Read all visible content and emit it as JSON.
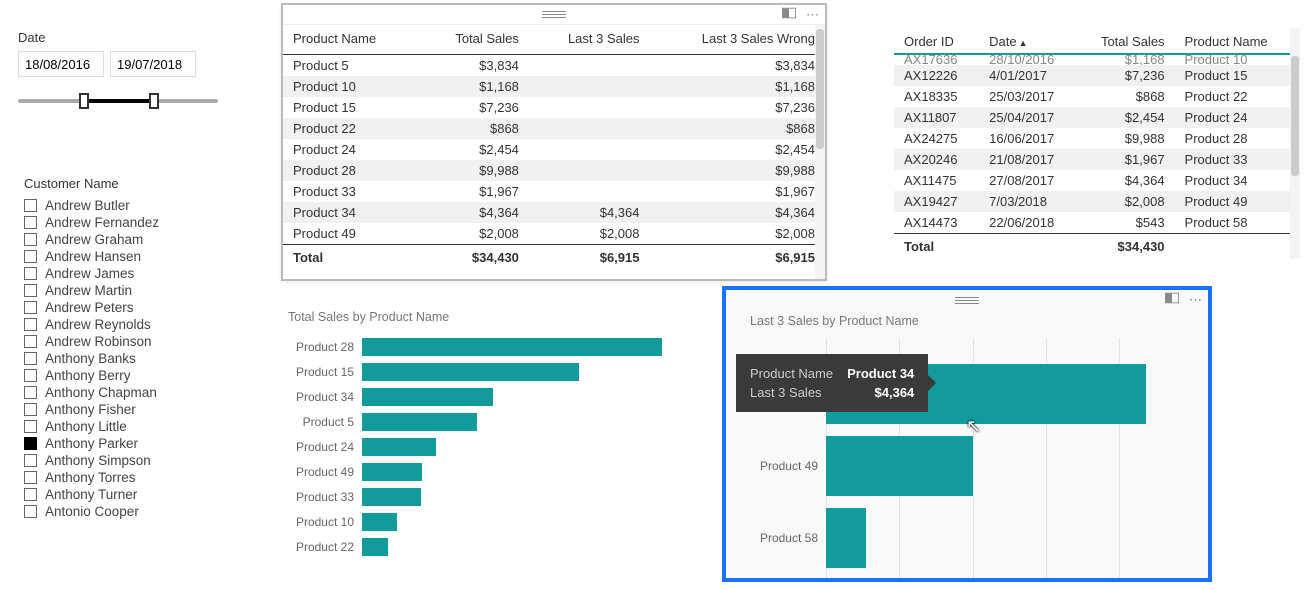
{
  "date_slicer": {
    "label": "Date",
    "start": "18/08/2016",
    "end": "19/07/2018",
    "range_start_pct": 33,
    "range_end_pct": 68
  },
  "customer_slicer": {
    "label": "Customer Name",
    "items": [
      {
        "name": "Andrew Butler",
        "checked": false
      },
      {
        "name": "Andrew Fernandez",
        "checked": false
      },
      {
        "name": "Andrew Graham",
        "checked": false
      },
      {
        "name": "Andrew Hansen",
        "checked": false
      },
      {
        "name": "Andrew James",
        "checked": false
      },
      {
        "name": "Andrew Martin",
        "checked": false
      },
      {
        "name": "Andrew Peters",
        "checked": false
      },
      {
        "name": "Andrew Reynolds",
        "checked": false
      },
      {
        "name": "Andrew Robinson",
        "checked": false
      },
      {
        "name": "Anthony Banks",
        "checked": false
      },
      {
        "name": "Anthony Berry",
        "checked": false
      },
      {
        "name": "Anthony Chapman",
        "checked": false
      },
      {
        "name": "Anthony Fisher",
        "checked": false
      },
      {
        "name": "Anthony Little",
        "checked": false
      },
      {
        "name": "Anthony Parker",
        "checked": true
      },
      {
        "name": "Anthony Simpson",
        "checked": false
      },
      {
        "name": "Anthony Torres",
        "checked": false
      },
      {
        "name": "Anthony Turner",
        "checked": false
      },
      {
        "name": "Antonio Cooper",
        "checked": false
      }
    ]
  },
  "table1": {
    "headers": [
      "Product Name",
      "Total Sales",
      "Last 3 Sales",
      "Last 3 Sales Wrong"
    ],
    "rows": [
      {
        "product": "Product 5",
        "total": "$3,834",
        "last3": "",
        "last3w": "$3,834"
      },
      {
        "product": "Product 10",
        "total": "$1,168",
        "last3": "",
        "last3w": "$1,168"
      },
      {
        "product": "Product 15",
        "total": "$7,236",
        "last3": "",
        "last3w": "$7,236"
      },
      {
        "product": "Product 22",
        "total": "$868",
        "last3": "",
        "last3w": "$868"
      },
      {
        "product": "Product 24",
        "total": "$2,454",
        "last3": "",
        "last3w": "$2,454"
      },
      {
        "product": "Product 28",
        "total": "$9,988",
        "last3": "",
        "last3w": "$9,988"
      },
      {
        "product": "Product 33",
        "total": "$1,967",
        "last3": "",
        "last3w": "$1,967"
      },
      {
        "product": "Product 34",
        "total": "$4,364",
        "last3": "$4,364",
        "last3w": "$4,364"
      },
      {
        "product": "Product 49",
        "total": "$2,008",
        "last3": "$2,008",
        "last3w": "$2,008"
      }
    ],
    "footer": {
      "label": "Total",
      "total": "$34,430",
      "last3": "$6,915",
      "last3w": "$6,915"
    }
  },
  "table2": {
    "headers": [
      "Order ID",
      "Date",
      "Total Sales",
      "Product Name"
    ],
    "sort_col": 1,
    "partial_row": {
      "order": "AX17636",
      "date": "28/10/2016",
      "total": "$1,168",
      "product": "Product 10"
    },
    "rows": [
      {
        "order": "AX12226",
        "date": "4/01/2017",
        "total": "$7,236",
        "product": "Product 15"
      },
      {
        "order": "AX18335",
        "date": "25/03/2017",
        "total": "$868",
        "product": "Product 22"
      },
      {
        "order": "AX11807",
        "date": "25/04/2017",
        "total": "$2,454",
        "product": "Product 24"
      },
      {
        "order": "AX24275",
        "date": "16/06/2017",
        "total": "$9,988",
        "product": "Product 28"
      },
      {
        "order": "AX20246",
        "date": "21/08/2017",
        "total": "$1,967",
        "product": "Product 33"
      },
      {
        "order": "AX11475",
        "date": "27/08/2017",
        "total": "$4,364",
        "product": "Product 34"
      },
      {
        "order": "AX19427",
        "date": "7/03/2018",
        "total": "$2,008",
        "product": "Product 49"
      },
      {
        "order": "AX14473",
        "date": "22/06/2018",
        "total": "$543",
        "product": "Product 58"
      }
    ],
    "footer": {
      "label": "Total",
      "total": "$34,430"
    }
  },
  "chart_data": [
    {
      "id": "total_sales_chart",
      "type": "bar",
      "title": "Total Sales by Product Name",
      "xlabel": "",
      "ylabel": "",
      "categories": [
        "Product 28",
        "Product 15",
        "Product 34",
        "Product 5",
        "Product 24",
        "Product 49",
        "Product 33",
        "Product 10",
        "Product 22"
      ],
      "values": [
        9988,
        7236,
        4364,
        3834,
        2454,
        2008,
        1967,
        1168,
        868
      ],
      "max": 10000
    },
    {
      "id": "last3_sales_chart",
      "type": "bar",
      "title": "Last 3 Sales by Product Name",
      "xlabel": "",
      "ylabel": "",
      "categories": [
        "Product 34",
        "Product 49",
        "Product 58"
      ],
      "values": [
        4364,
        2008,
        543
      ],
      "max": 4500,
      "gridlines": [
        0,
        1000,
        2000,
        3000,
        4000
      ]
    }
  ],
  "tooltip": {
    "rows": [
      {
        "k": "Product Name",
        "v": "Product 34"
      },
      {
        "k": "Last 3 Sales",
        "v": "$4,364"
      }
    ]
  },
  "icons": {
    "focus": "focus-mode-icon",
    "more": "⋯"
  }
}
